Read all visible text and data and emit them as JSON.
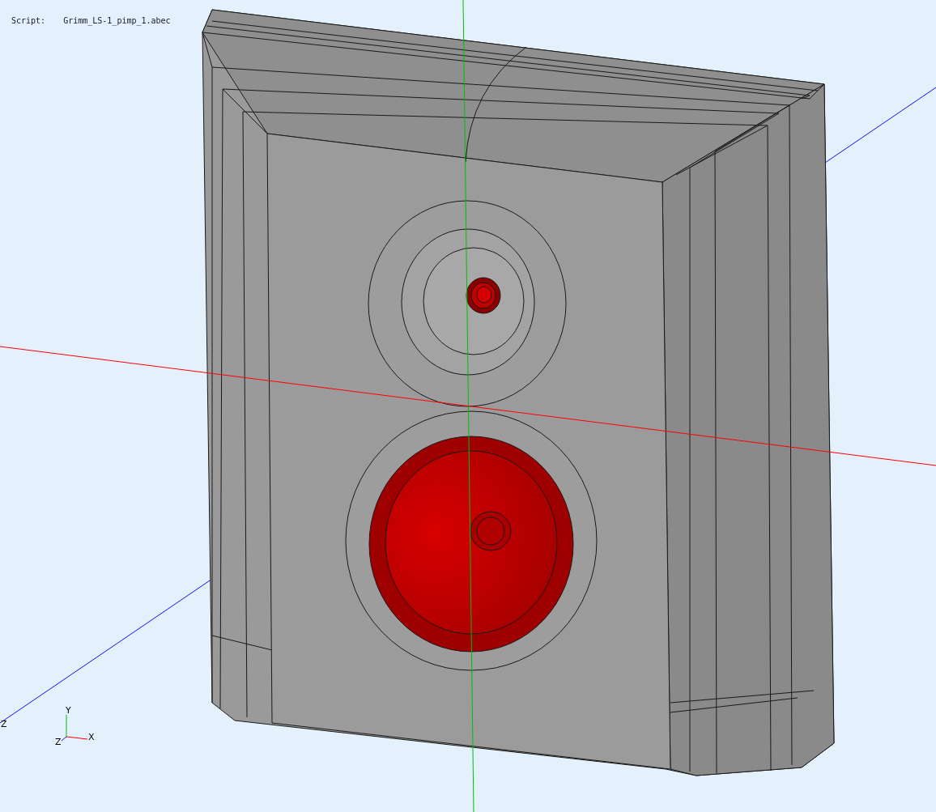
{
  "script": {
    "label": "Script:",
    "file": "Grimm_LS-1_pimp_1.abec"
  },
  "viewport": {
    "axis_label": "Z",
    "gizmo": {
      "y": "Y",
      "z": "Z",
      "x": "X"
    }
  }
}
